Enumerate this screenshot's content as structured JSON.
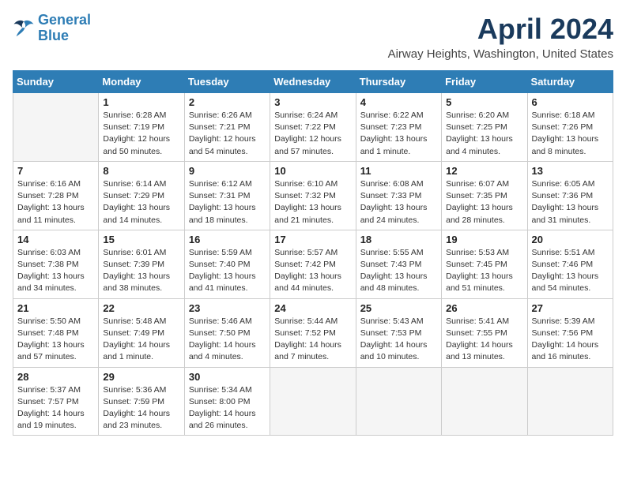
{
  "header": {
    "logo_line1": "General",
    "logo_line2": "Blue",
    "month": "April 2024",
    "location": "Airway Heights, Washington, United States"
  },
  "weekdays": [
    "Sunday",
    "Monday",
    "Tuesday",
    "Wednesday",
    "Thursday",
    "Friday",
    "Saturday"
  ],
  "weeks": [
    [
      {
        "day": "",
        "text": ""
      },
      {
        "day": "1",
        "text": "Sunrise: 6:28 AM\nSunset: 7:19 PM\nDaylight: 12 hours\nand 50 minutes."
      },
      {
        "day": "2",
        "text": "Sunrise: 6:26 AM\nSunset: 7:21 PM\nDaylight: 12 hours\nand 54 minutes."
      },
      {
        "day": "3",
        "text": "Sunrise: 6:24 AM\nSunset: 7:22 PM\nDaylight: 12 hours\nand 57 minutes."
      },
      {
        "day": "4",
        "text": "Sunrise: 6:22 AM\nSunset: 7:23 PM\nDaylight: 13 hours\nand 1 minute."
      },
      {
        "day": "5",
        "text": "Sunrise: 6:20 AM\nSunset: 7:25 PM\nDaylight: 13 hours\nand 4 minutes."
      },
      {
        "day": "6",
        "text": "Sunrise: 6:18 AM\nSunset: 7:26 PM\nDaylight: 13 hours\nand 8 minutes."
      }
    ],
    [
      {
        "day": "7",
        "text": "Sunrise: 6:16 AM\nSunset: 7:28 PM\nDaylight: 13 hours\nand 11 minutes."
      },
      {
        "day": "8",
        "text": "Sunrise: 6:14 AM\nSunset: 7:29 PM\nDaylight: 13 hours\nand 14 minutes."
      },
      {
        "day": "9",
        "text": "Sunrise: 6:12 AM\nSunset: 7:31 PM\nDaylight: 13 hours\nand 18 minutes."
      },
      {
        "day": "10",
        "text": "Sunrise: 6:10 AM\nSunset: 7:32 PM\nDaylight: 13 hours\nand 21 minutes."
      },
      {
        "day": "11",
        "text": "Sunrise: 6:08 AM\nSunset: 7:33 PM\nDaylight: 13 hours\nand 24 minutes."
      },
      {
        "day": "12",
        "text": "Sunrise: 6:07 AM\nSunset: 7:35 PM\nDaylight: 13 hours\nand 28 minutes."
      },
      {
        "day": "13",
        "text": "Sunrise: 6:05 AM\nSunset: 7:36 PM\nDaylight: 13 hours\nand 31 minutes."
      }
    ],
    [
      {
        "day": "14",
        "text": "Sunrise: 6:03 AM\nSunset: 7:38 PM\nDaylight: 13 hours\nand 34 minutes."
      },
      {
        "day": "15",
        "text": "Sunrise: 6:01 AM\nSunset: 7:39 PM\nDaylight: 13 hours\nand 38 minutes."
      },
      {
        "day": "16",
        "text": "Sunrise: 5:59 AM\nSunset: 7:40 PM\nDaylight: 13 hours\nand 41 minutes."
      },
      {
        "day": "17",
        "text": "Sunrise: 5:57 AM\nSunset: 7:42 PM\nDaylight: 13 hours\nand 44 minutes."
      },
      {
        "day": "18",
        "text": "Sunrise: 5:55 AM\nSunset: 7:43 PM\nDaylight: 13 hours\nand 48 minutes."
      },
      {
        "day": "19",
        "text": "Sunrise: 5:53 AM\nSunset: 7:45 PM\nDaylight: 13 hours\nand 51 minutes."
      },
      {
        "day": "20",
        "text": "Sunrise: 5:51 AM\nSunset: 7:46 PM\nDaylight: 13 hours\nand 54 minutes."
      }
    ],
    [
      {
        "day": "21",
        "text": "Sunrise: 5:50 AM\nSunset: 7:48 PM\nDaylight: 13 hours\nand 57 minutes."
      },
      {
        "day": "22",
        "text": "Sunrise: 5:48 AM\nSunset: 7:49 PM\nDaylight: 14 hours\nand 1 minute."
      },
      {
        "day": "23",
        "text": "Sunrise: 5:46 AM\nSunset: 7:50 PM\nDaylight: 14 hours\nand 4 minutes."
      },
      {
        "day": "24",
        "text": "Sunrise: 5:44 AM\nSunset: 7:52 PM\nDaylight: 14 hours\nand 7 minutes."
      },
      {
        "day": "25",
        "text": "Sunrise: 5:43 AM\nSunset: 7:53 PM\nDaylight: 14 hours\nand 10 minutes."
      },
      {
        "day": "26",
        "text": "Sunrise: 5:41 AM\nSunset: 7:55 PM\nDaylight: 14 hours\nand 13 minutes."
      },
      {
        "day": "27",
        "text": "Sunrise: 5:39 AM\nSunset: 7:56 PM\nDaylight: 14 hours\nand 16 minutes."
      }
    ],
    [
      {
        "day": "28",
        "text": "Sunrise: 5:37 AM\nSunset: 7:57 PM\nDaylight: 14 hours\nand 19 minutes."
      },
      {
        "day": "29",
        "text": "Sunrise: 5:36 AM\nSunset: 7:59 PM\nDaylight: 14 hours\nand 23 minutes."
      },
      {
        "day": "30",
        "text": "Sunrise: 5:34 AM\nSunset: 8:00 PM\nDaylight: 14 hours\nand 26 minutes."
      },
      {
        "day": "",
        "text": ""
      },
      {
        "day": "",
        "text": ""
      },
      {
        "day": "",
        "text": ""
      },
      {
        "day": "",
        "text": ""
      }
    ]
  ]
}
